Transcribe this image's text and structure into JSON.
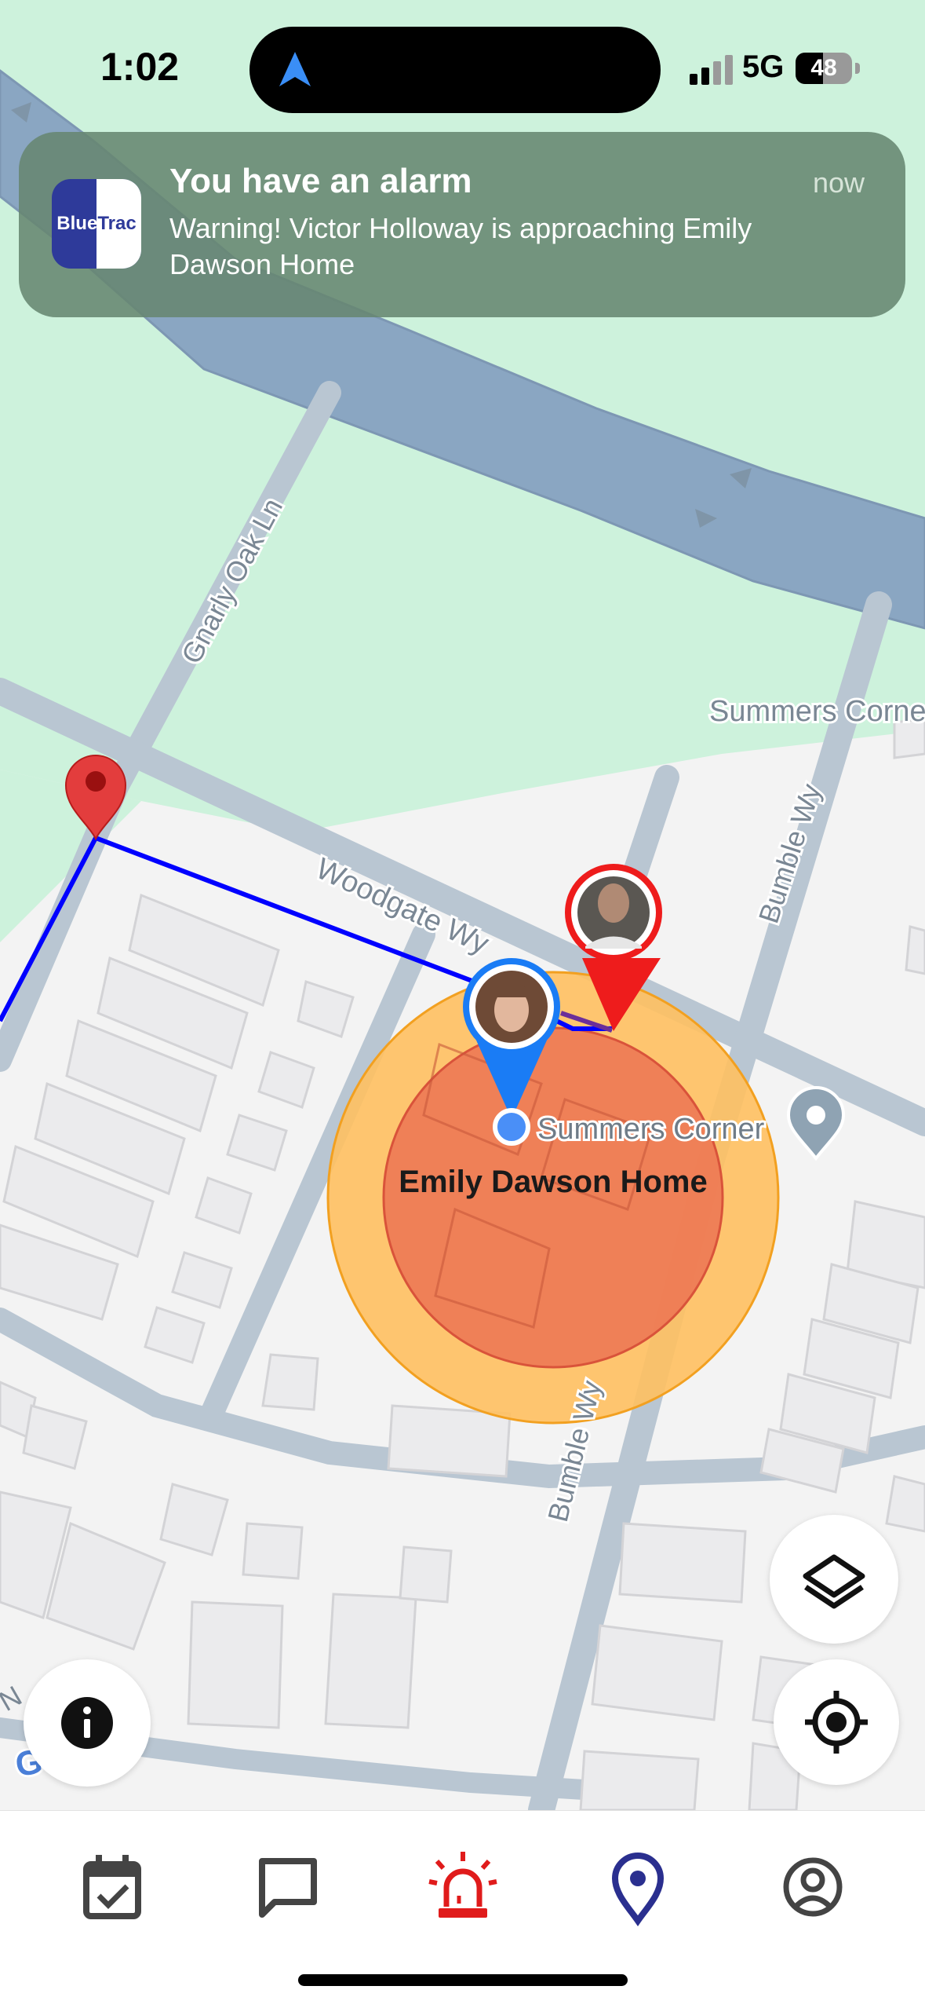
{
  "status": {
    "time": "1:02",
    "network": "5G",
    "battery": "48",
    "battery_level": 0.48
  },
  "notification": {
    "app_icon": "BlueTrac",
    "title": "You have an alarm",
    "time": "now",
    "message": "Warning! Victor Holloway is approaching Emily Dawson Home"
  },
  "map": {
    "streets": {
      "gnarly_oak": "Gnarly Oak Ln",
      "woodgate": "Woodgate Wy",
      "bumble_north": "Bumble Wy",
      "bumble_south": "Bumble Wy",
      "summers_top": "Summers Corner",
      "corner_fragment": "N"
    },
    "place_label": "Summers Corner",
    "geofence_label": "Emily Dawson Home",
    "provider": "Google",
    "colors": {
      "water": "#8aa6c2",
      "park": "#cdf2dc",
      "route": "#0000ff",
      "geofence_outer": "#ffc060",
      "geofence_inner": "#ee7a55",
      "alarm_pin": "#e01b1b",
      "user_pin": "#1a7cf5"
    }
  },
  "tabs": [
    {
      "icon": "calendar-check-icon",
      "color": "#444444"
    },
    {
      "icon": "chat-icon",
      "color": "#444444"
    },
    {
      "icon": "siren-alarm-icon",
      "color": "#e01b1b"
    },
    {
      "icon": "location-pin-icon",
      "color": "#2a2f8f"
    },
    {
      "icon": "account-icon",
      "color": "#444444"
    }
  ]
}
